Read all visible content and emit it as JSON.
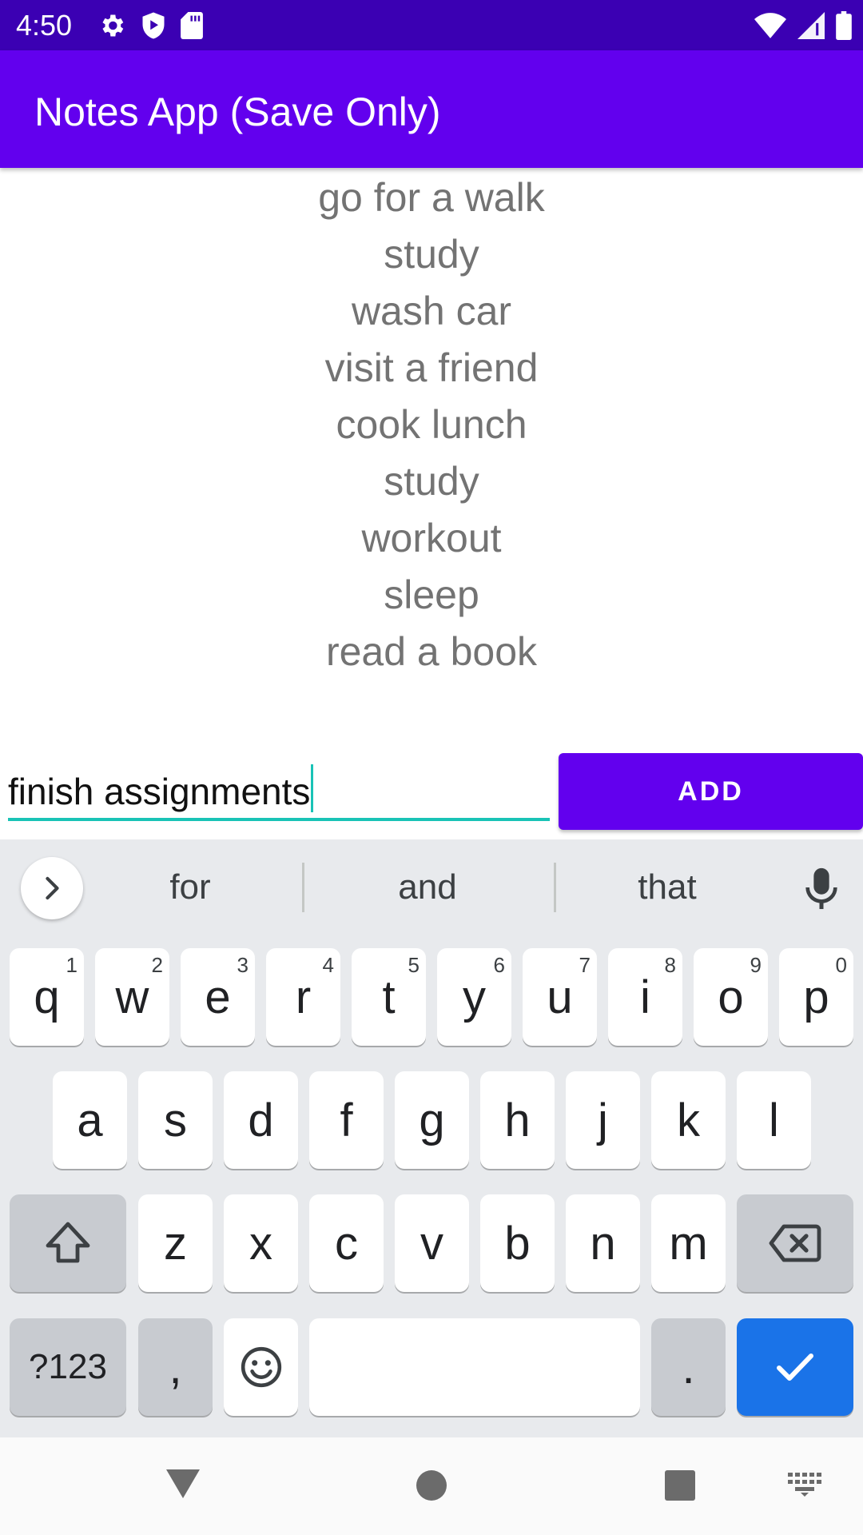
{
  "status_bar": {
    "time": "4:50",
    "left_icons": [
      "settings-icon",
      "shield-play-icon",
      "sd-card-icon"
    ],
    "right_icons": [
      "wifi-icon",
      "signal-icon",
      "battery-icon"
    ],
    "background": "#3b00b3"
  },
  "app_bar": {
    "title": "Notes App (Save Only)",
    "background": "#6200ee"
  },
  "notes": [
    "go for a walk",
    "study",
    "wash car",
    "visit a friend",
    "cook lunch",
    "study",
    "workout",
    "sleep",
    "read a book"
  ],
  "input": {
    "value": "finish assignments",
    "accent": "#19c3b6"
  },
  "add_button": {
    "label": "ADD",
    "background": "#6200ee"
  },
  "keyboard": {
    "suggestions": [
      "for",
      "and",
      "that"
    ],
    "rows": [
      [
        {
          "label": "q",
          "hint": "1"
        },
        {
          "label": "w",
          "hint": "2"
        },
        {
          "label": "e",
          "hint": "3"
        },
        {
          "label": "r",
          "hint": "4"
        },
        {
          "label": "t",
          "hint": "5"
        },
        {
          "label": "y",
          "hint": "6"
        },
        {
          "label": "u",
          "hint": "7"
        },
        {
          "label": "i",
          "hint": "8"
        },
        {
          "label": "o",
          "hint": "9"
        },
        {
          "label": "p",
          "hint": "0"
        }
      ],
      [
        {
          "label": "a"
        },
        {
          "label": "s"
        },
        {
          "label": "d"
        },
        {
          "label": "f"
        },
        {
          "label": "g"
        },
        {
          "label": "h"
        },
        {
          "label": "j"
        },
        {
          "label": "k"
        },
        {
          "label": "l"
        }
      ],
      [
        {
          "label": "z"
        },
        {
          "label": "x"
        },
        {
          "label": "c"
        },
        {
          "label": "v"
        },
        {
          "label": "b"
        },
        {
          "label": "n"
        },
        {
          "label": "m"
        }
      ]
    ],
    "symbols_label": "?123",
    "comma_label": ",",
    "period_label": ".",
    "icons": [
      "shift-icon",
      "backspace-icon",
      "emoji-icon",
      "checkmark-icon",
      "mic-icon",
      "chevron-right-icon"
    ],
    "action_color": "#1a73e8"
  },
  "nav_bar": {
    "icons": [
      "back-icon",
      "home-icon",
      "recents-icon",
      "keyboard-switch-icon"
    ]
  }
}
